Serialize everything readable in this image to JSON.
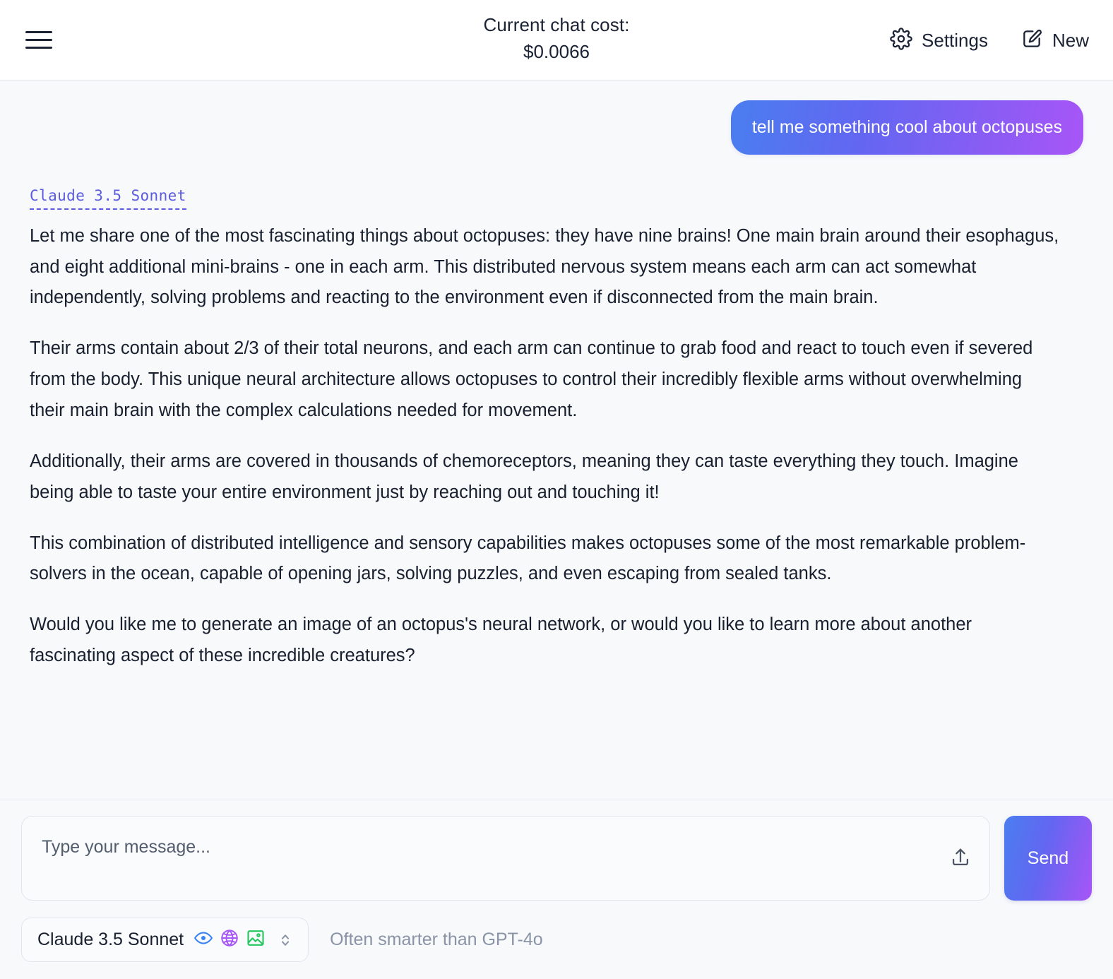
{
  "header": {
    "menu_icon": "hamburger-menu-icon",
    "cost_label": "Current chat cost:",
    "cost_value": "$0.0066",
    "settings": {
      "icon": "gear-icon",
      "label": "Settings"
    },
    "new_chat": {
      "icon": "compose-pencil-icon",
      "label": "New"
    }
  },
  "conversation": {
    "user_message": "tell me something cool about octopuses",
    "assistant": {
      "model_tag": "Claude 3.5 Sonnet",
      "paragraphs": [
        "Let me share one of the most fascinating things about octopuses: they have nine brains! One main brain around their esophagus, and eight additional mini-brains - one in each arm. This distributed nervous system means each arm can act somewhat independently, solving problems and reacting to the environment even if disconnected from the main brain.",
        "Their arms contain about 2/3 of their total neurons, and each arm can continue to grab food and react to touch even if severed from the body. This unique neural architecture allows octopuses to control their incredibly flexible arms without overwhelming their main brain with the complex calculations needed for movement.",
        "Additionally, their arms are covered in thousands of chemoreceptors, meaning they can taste everything they touch. Imagine being able to taste your entire environment just by reaching out and touching it!",
        "This combination of distributed intelligence and sensory capabilities makes octopuses some of the most remarkable problem-solvers in the ocean, capable of opening jars, solving puzzles, and even escaping from sealed tanks.",
        "Would you like me to generate an image of an octopus's neural network, or would you like to learn more about another fascinating aspect of these incredible creatures?"
      ]
    }
  },
  "composer": {
    "placeholder": "Type your message...",
    "value": "",
    "upload_icon": "upload-icon",
    "send_label": "Send"
  },
  "model_bar": {
    "selected_model": "Claude 3.5 Sonnet",
    "capabilities": [
      {
        "icon": "eye-icon",
        "name": "vision",
        "color": "#3b82f6"
      },
      {
        "icon": "globe-icon",
        "name": "web",
        "color": "#a855f7"
      },
      {
        "icon": "image-icon",
        "name": "image-generation",
        "color": "#22c55e"
      }
    ],
    "chevron_icon": "chevron-up-down-icon",
    "hint": "Often smarter than GPT-4o"
  },
  "colors": {
    "background": "#f8f9fb",
    "header_background": "#ffffff",
    "text": "#18202f",
    "muted_text": "#8a94a6",
    "gradient_start": "#4a7ef0",
    "gradient_end": "#a855f7",
    "model_tag": "#5b5be0"
  }
}
